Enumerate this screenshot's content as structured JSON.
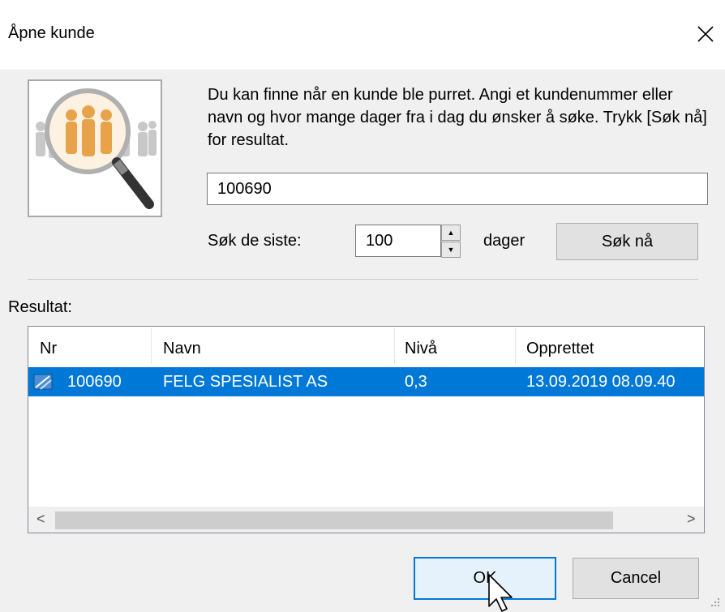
{
  "window": {
    "title": "Åpne kunde"
  },
  "description": "Du kan finne når en kunde ble purret. Angi et kundenummer eller navn og hvor mange dager fra i dag du ønsker å søke.  Trykk [Søk nå] for resultat.",
  "search": {
    "customer_value": "100690"
  },
  "days": {
    "label": "Søk de siste:",
    "value": "100",
    "suffix": "dager"
  },
  "buttons": {
    "search": "Søk nå",
    "ok": "OK",
    "cancel": "Cancel"
  },
  "results": {
    "label": "Resultat:",
    "columns": [
      "Nr",
      "Navn",
      "Nivå",
      "Opprettet"
    ],
    "rows": [
      {
        "nr": "100690",
        "navn": "FELG SPESIALIST AS",
        "niva": "0,3",
        "opprettet": "13.09.2019 08.09.40"
      }
    ]
  },
  "colors": {
    "selection": "#0078d7",
    "background": "#f0f0f0"
  }
}
